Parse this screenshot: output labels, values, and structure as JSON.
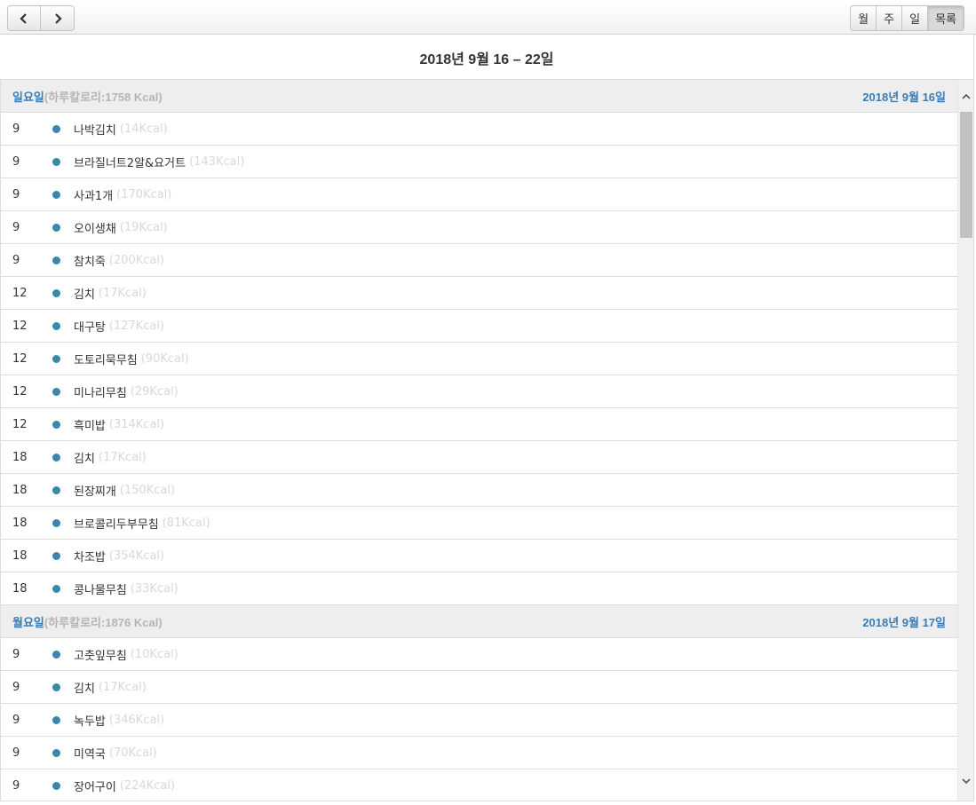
{
  "toolbar": {
    "prev_icon": "chevron-left-icon",
    "next_icon": "chevron-right-icon",
    "views": [
      {
        "label": "월",
        "active": false
      },
      {
        "label": "주",
        "active": false
      },
      {
        "label": "일",
        "active": false
      },
      {
        "label": "목록",
        "active": true
      }
    ]
  },
  "title": "2018년 9월 16 – 22일",
  "days": [
    {
      "day_name": "일요일",
      "calories": "(하루칼로리:1758 Kcal)",
      "date": "2018년 9월 16일",
      "items": [
        {
          "time": "9",
          "name": "나박김치",
          "kcal": "(14Kcal)"
        },
        {
          "time": "9",
          "name": "브라질너트2알&요거트",
          "kcal": "(143Kcal)"
        },
        {
          "time": "9",
          "name": "사과1개",
          "kcal": "(170Kcal)"
        },
        {
          "time": "9",
          "name": "오이생채",
          "kcal": "(19Kcal)"
        },
        {
          "time": "9",
          "name": "참치죽",
          "kcal": "(200Kcal)"
        },
        {
          "time": "12",
          "name": "김치",
          "kcal": "(17Kcal)"
        },
        {
          "time": "12",
          "name": "대구탕",
          "kcal": "(127Kcal)"
        },
        {
          "time": "12",
          "name": "도토리묵무침",
          "kcal": "(90Kcal)"
        },
        {
          "time": "12",
          "name": "미나리무침",
          "kcal": "(29Kcal)"
        },
        {
          "time": "12",
          "name": "흑미밥",
          "kcal": "(314Kcal)"
        },
        {
          "time": "18",
          "name": "김치",
          "kcal": "(17Kcal)"
        },
        {
          "time": "18",
          "name": "된장찌개",
          "kcal": "(150Kcal)"
        },
        {
          "time": "18",
          "name": "브로콜리두부무침",
          "kcal": "(81Kcal)"
        },
        {
          "time": "18",
          "name": "차조밥",
          "kcal": "(354Kcal)"
        },
        {
          "time": "18",
          "name": "콩나물무침",
          "kcal": "(33Kcal)"
        }
      ]
    },
    {
      "day_name": "월요일",
      "calories": "(하루칼로리:1876 Kcal)",
      "date": "2018년 9월 17일",
      "items": [
        {
          "time": "9",
          "name": "고춧잎무침",
          "kcal": "(10Kcal)"
        },
        {
          "time": "9",
          "name": "김치",
          "kcal": "(17Kcal)"
        },
        {
          "time": "9",
          "name": "녹두밥",
          "kcal": "(346Kcal)"
        },
        {
          "time": "9",
          "name": "미역국",
          "kcal": "(70Kcal)"
        },
        {
          "time": "9",
          "name": "장어구이",
          "kcal": "(224Kcal)"
        }
      ]
    }
  ],
  "colors": {
    "accent": "#3a7bb5",
    "dot": "#3a87ad",
    "muted": "#d8d8d8"
  }
}
